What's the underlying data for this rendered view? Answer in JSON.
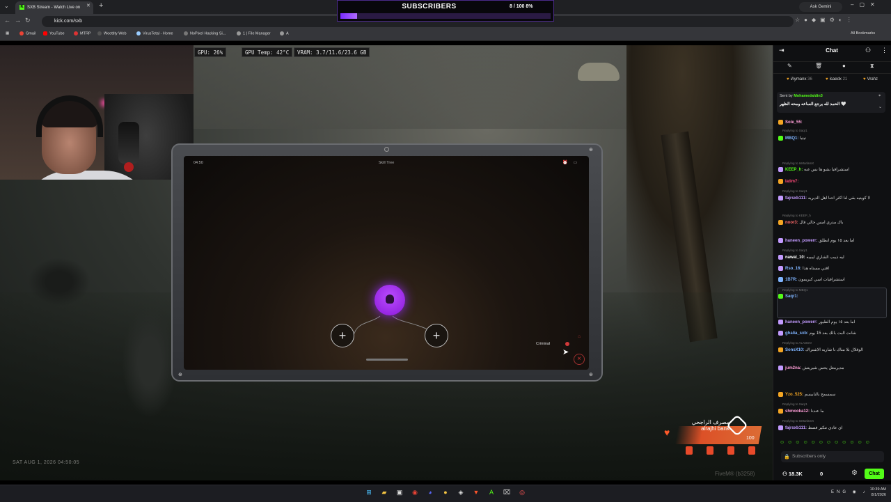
{
  "browser": {
    "tab_title": "SXB Stream - Watch Live on",
    "url": "kick.com/sxb",
    "ask_gemini": "Ask Gemini",
    "bookmarks": [
      "Gmail",
      "YouTube",
      "MTRP",
      "Woottity Web",
      "VirusTotal - Home",
      "NoPixel Hacking Si...",
      "1 | File Manager",
      "A"
    ],
    "all_bookmarks": "All Bookmarks"
  },
  "subscribers": {
    "title": "SUBSCRIBERS",
    "count": "8 / 100",
    "percent": "8%",
    "progress": 0.08
  },
  "gpu": {
    "usage": "GPU: 26%",
    "temp": "GPU Temp: 42°C",
    "vram": "VRAM: 3.7/11.6/23.6 GB"
  },
  "tablet": {
    "time": "04:50",
    "title": "Skill Tree",
    "criminal_label": "Criminal"
  },
  "game": {
    "timestamp": "SAT AUG 1, 2026 04:50:05",
    "watermark": "FiveM® (b3258)",
    "bank_ar": "مصرف الراجحي",
    "bank_en": "alrajhi bank",
    "health": "100"
  },
  "chat": {
    "title": "Chat",
    "gifters": [
      {
        "name": "iAymanx",
        "count": "36"
      },
      {
        "name": "isaedx",
        "count": "21"
      },
      {
        "name": "Vrahz",
        "count": ""
      }
    ],
    "pinned_by": "Sent by",
    "pinned_user": "Mohamedaldin3",
    "pinned_text": "الحمد لله يرجع الساعه ومحه الظهر 🤍",
    "messages": [
      {
        "user": "",
        "text": "جيمي الكبير سالمبوليبي بلوقا",
        "color": "#c8a2ff"
      },
      {
        "user": "Sole_55:",
        "text": "",
        "color": "#ff9ed8"
      },
      {
        "user": "MBQ1:",
        "text": "تيتيا",
        "color": "#7fb4ff"
      },
      {
        "user": "KEEP_h:",
        "text": "استشرافيا بشو ها بس عبه",
        "color": "#53fc18"
      },
      {
        "user": "latim7:",
        "text": "",
        "color": "#ff4a7a"
      },
      {
        "user": "fajrsxb111:",
        "text": "لا كويتيه بقى لنا اكثر احنا اهل الديريه",
        "color": "#c39bff"
      },
      {
        "user": "noor3:",
        "text": "باك مدري امس خالي قال",
        "color": "#ff6a6a"
      },
      {
        "user": "haneen_powerr:",
        "text": "اما بعد ١٥ يوم انطلق",
        "color": "#c39bff"
      },
      {
        "user": "nawal_10:",
        "text": "ليه ذيبب الشاري ليبيبه",
        "color": "#ffffff"
      },
      {
        "user": "Rso_16:",
        "text": "اقتي مستاه هذا",
        "color": "#7fb4ff"
      },
      {
        "user": "1B7R:",
        "text": "استشرافيات اسي كبريمون",
        "color": "#7fb4ff"
      },
      {
        "user": "Saqr1:",
        "text": "",
        "color": "#7fb4ff"
      },
      {
        "user": "haneen_powerr:",
        "text": "اما بعد ١٥ يوم الطيور",
        "color": "#c39bff"
      },
      {
        "user": "ghalia_sxb:",
        "text": "شانت البت بالك بعد 15 يوم",
        "color": "#7fb4ff"
      },
      {
        "user": "SonsX10:",
        "text": "الوقلال بلا متاك نا شاريه الاشتراك",
        "color": "#7fb4ff"
      },
      {
        "user": "jum2na:",
        "text": "مديرمعل يحس شيريتش",
        "color": "#ff9ed8"
      },
      {
        "user": "Yzo_525:",
        "text": "سمسمح بالنابيسم",
        "color": "#f5a623"
      },
      {
        "user": "shmooka12:",
        "text": "ما عندنا",
        "color": "#ff9ed8"
      },
      {
        "user": "fajrsxb111:",
        "text": "اي عادي تتكير فصط",
        "color": "#c39bff"
      }
    ],
    "replying_prefix": "Replying to",
    "input_placeholder": "Subscribers only",
    "viewers": "18.3K",
    "zero": "0",
    "send_label": "Chat"
  },
  "taskbar": {
    "lang": "ENG",
    "time": "10:39 AM",
    "date": "8/1/2026"
  }
}
